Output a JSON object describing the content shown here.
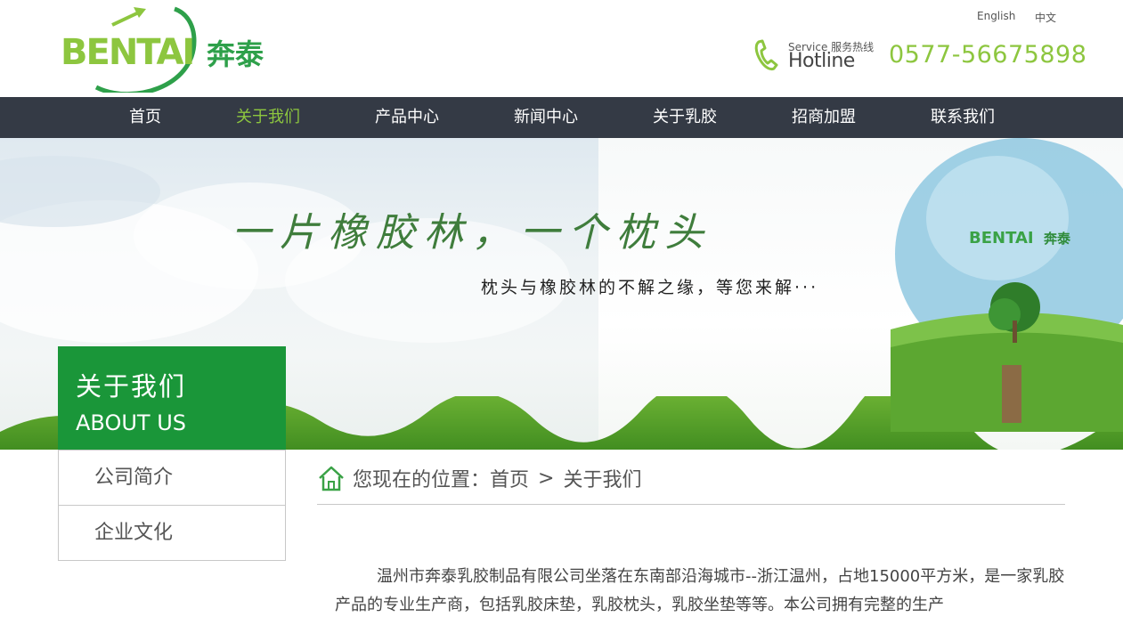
{
  "header": {
    "logo_text_en": "BENTAI",
    "logo_text_cn": "奔泰",
    "lang_en": "English",
    "lang_cn": "中文",
    "hotline_service": "Service 服务热线",
    "hotline_label": "Hotline",
    "phone": "0577-56675898"
  },
  "nav": {
    "items": [
      {
        "label": "首页",
        "active": false
      },
      {
        "label": "关于我们",
        "active": true
      },
      {
        "label": "产品中心",
        "active": false
      },
      {
        "label": "新闻中心",
        "active": false
      },
      {
        "label": "关于乳胶",
        "active": false
      },
      {
        "label": "招商加盟",
        "active": false
      },
      {
        "label": "联系我们",
        "active": false
      }
    ]
  },
  "banner": {
    "slogan": "一片橡胶林，一个枕头",
    "subslogan": "枕头与橡胶林的不解之缘，等您来解···",
    "tree_logo_en": "BENTAI",
    "tree_logo_cn": "奔泰"
  },
  "sidebar": {
    "title_cn": "关于我们",
    "title_en": "ABOUT US",
    "items": [
      {
        "label": "公司简介"
      },
      {
        "label": "企业文化"
      }
    ]
  },
  "breadcrumb": {
    "prefix": "您现在的位置：",
    "home": "首页",
    "separator": ">",
    "current": "关于我们"
  },
  "content": {
    "text": "温州市奔泰乳胶制品有限公司坐落在东南部沿海城市--浙江温州，占地15000平方米，是一家乳胶产品的专业生产商，包括乳胶床垫，乳胶枕头，乳胶坐垫等等。本公司拥有完整的生产"
  },
  "colors": {
    "brand_green": "#1a9639",
    "accent_green": "#8dc63f",
    "nav_bg": "#343a45"
  }
}
